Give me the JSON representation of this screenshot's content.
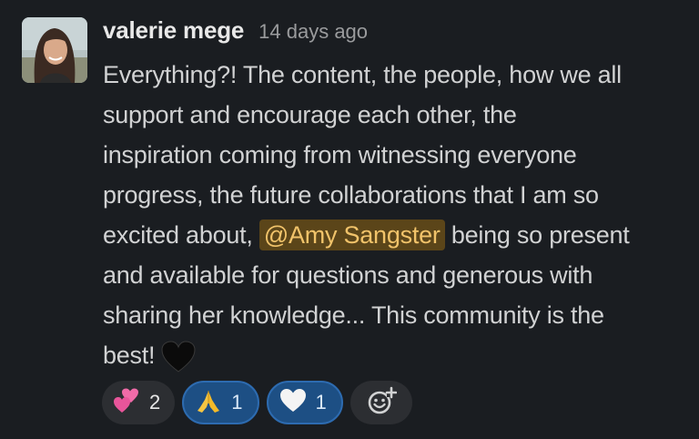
{
  "message": {
    "author": "valerie mege",
    "timestamp": "14 days ago",
    "lines": [
      "Everything?! The content, the people, how we all",
      "support and encourage each other, the",
      "inspiration coming from witnessing everyone",
      "progress, the future collaborations that I am so"
    ],
    "line5_before": "excited about, ",
    "mention": "@Amy Sangster",
    "line5_after": " being so present",
    "line6": "and available for questions and generous with",
    "line7": "sharing her knowledge... This community is the",
    "line8": "best!",
    "trailing_emoji": "black-heart"
  },
  "reactions": [
    {
      "emoji": "two-hearts",
      "count": "2",
      "active": false
    },
    {
      "emoji": "folded-hands",
      "count": "1",
      "active": true
    },
    {
      "emoji": "white-heart",
      "count": "1",
      "active": true
    }
  ],
  "add_reaction_icon": "add-emoji-icon",
  "colors": {
    "background": "#1a1d21",
    "mention_bg": "#5b4519",
    "mention_text": "#f1c36a",
    "active_reaction_bg": "#1d4f84"
  }
}
